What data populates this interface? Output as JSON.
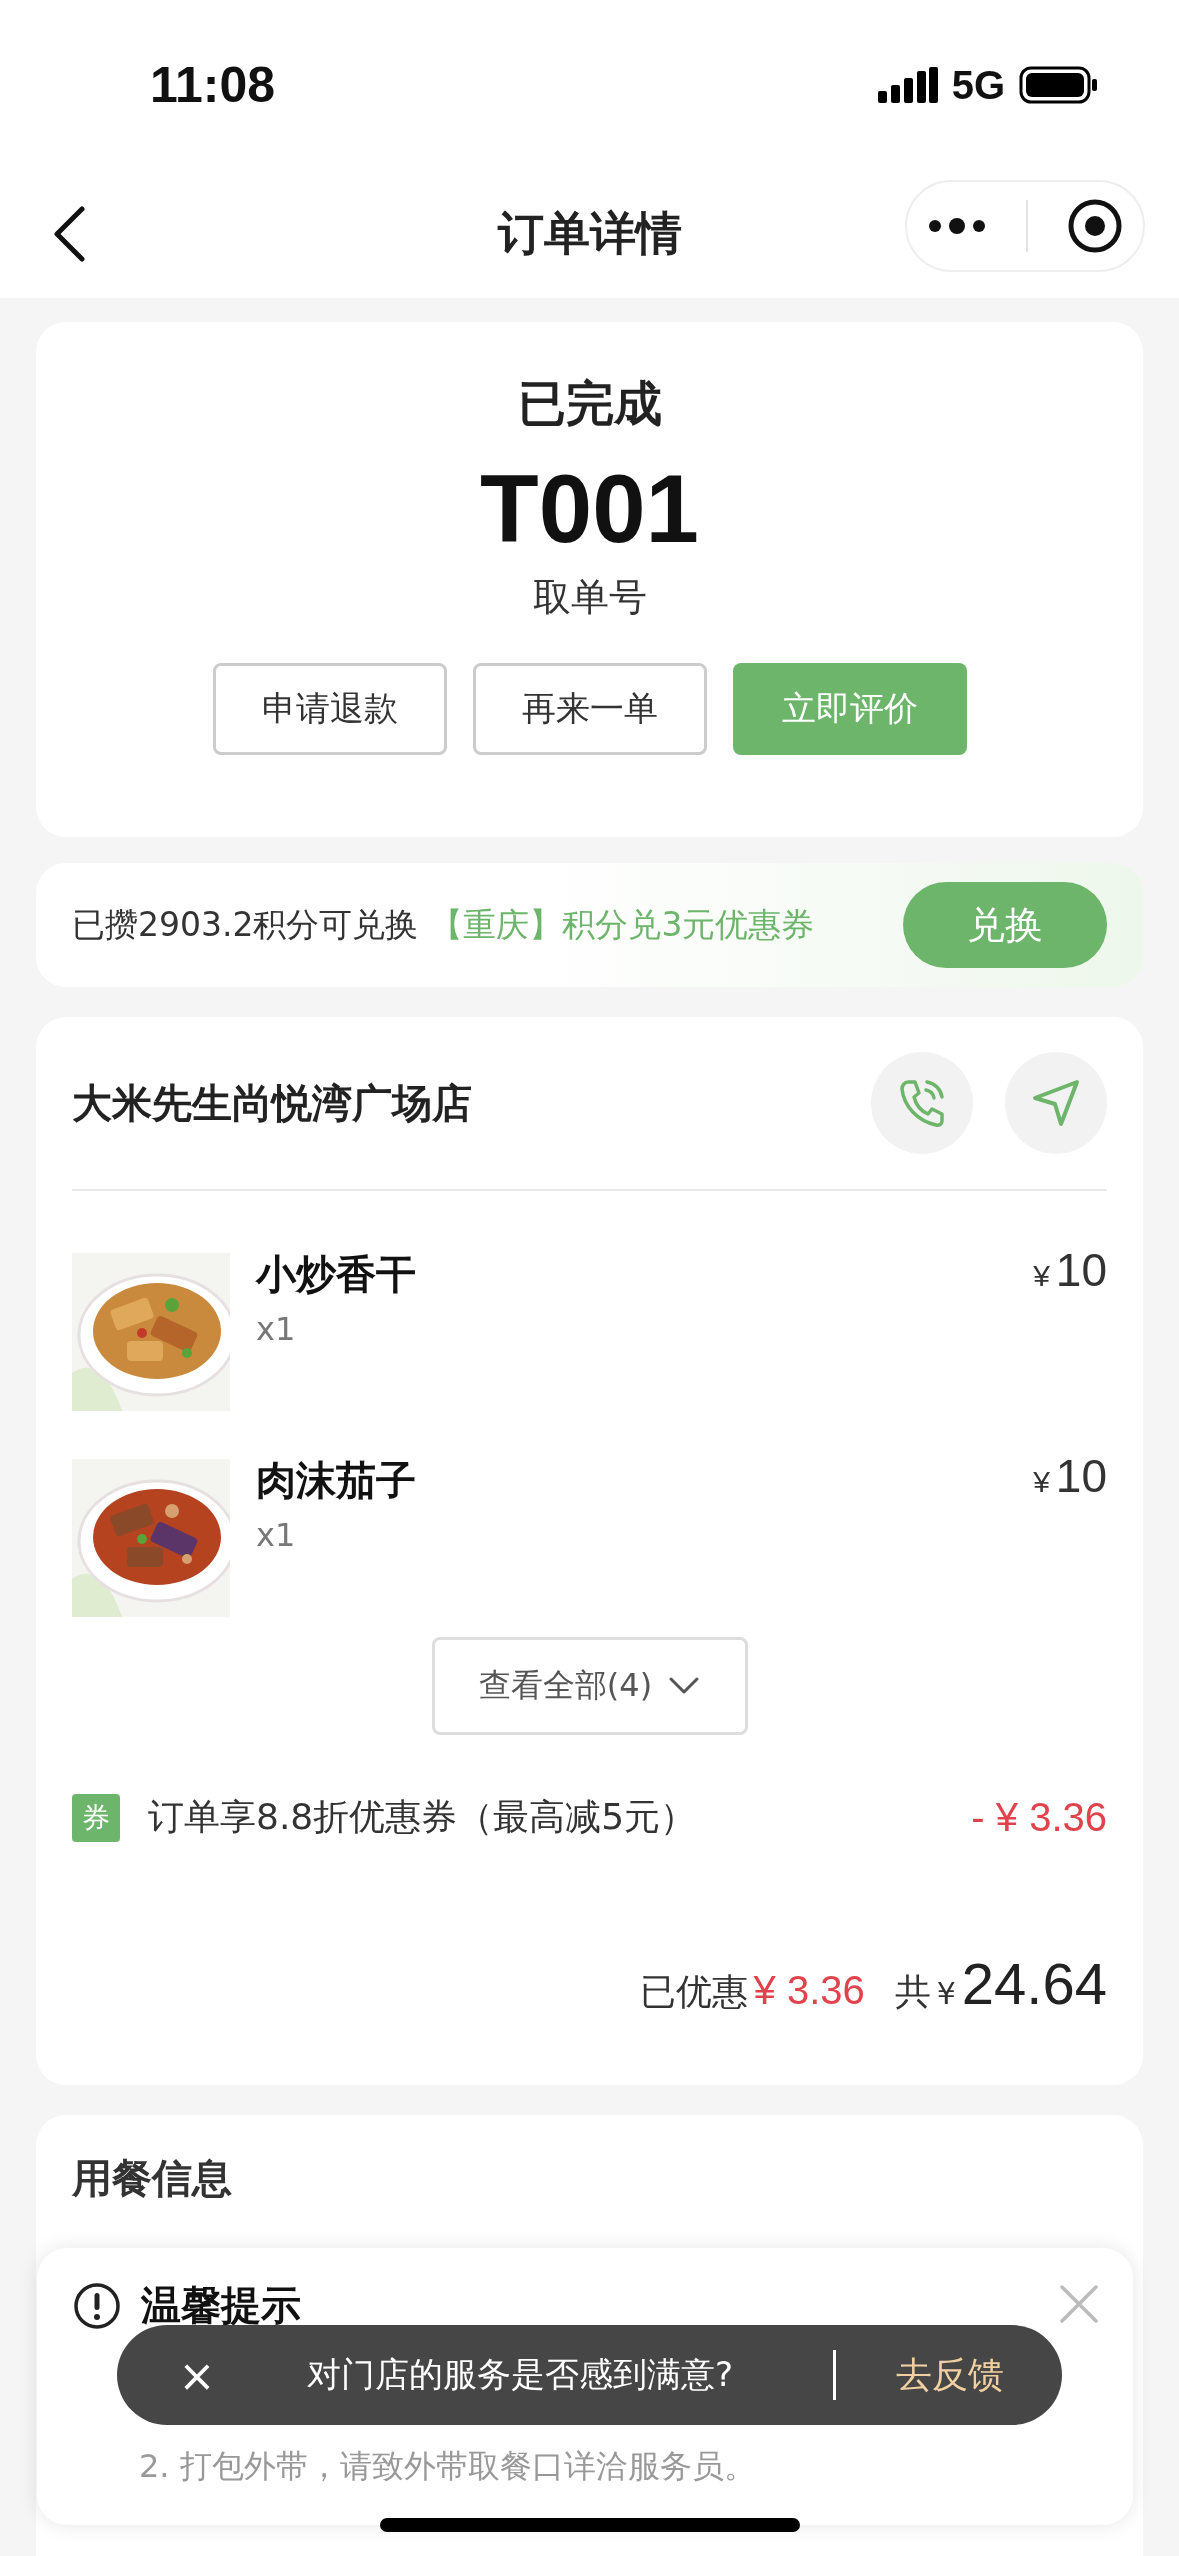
{
  "status_bar": {
    "time": "11:08",
    "network": "5G"
  },
  "nav": {
    "title": "订单详情"
  },
  "order": {
    "status": "已完成",
    "pickup_number": "T001",
    "pickup_label": "取单号",
    "actions": [
      {
        "label": "申请退款",
        "kind": "outline"
      },
      {
        "label": "再来一单",
        "kind": "outline"
      },
      {
        "label": "立即评价",
        "kind": "primary"
      }
    ]
  },
  "points_banner": {
    "text": "已攒2903.2积分可兑换",
    "offer": "【重庆】积分兑3元优惠券",
    "button": "兑换"
  },
  "store": {
    "name": "大米先生尚悦湾广场店",
    "items": [
      {
        "name": "小炒香干",
        "quantity": "x1",
        "currency": "¥",
        "price": "10",
        "kind": "tofu"
      },
      {
        "name": "肉沫茄子",
        "quantity": "x1",
        "currency": "¥",
        "price": "10",
        "kind": "eggplant"
      }
    ],
    "view_all": "查看全部(4)",
    "coupon": {
      "badge": "券",
      "text": "订单享8.8折优惠券（最高减5元）",
      "amount": "- ¥ 3.36"
    },
    "summary": {
      "discount_label": "已优惠",
      "discount": "¥ 3.36",
      "total_label": "共",
      "currency": "¥",
      "total": "24.64"
    }
  },
  "dining_info": {
    "title": "用餐信息"
  },
  "tip": {
    "title": "温馨提示",
    "lines": [
      "2. 打包外带，请致外带取餐口详洽服务员。"
    ]
  },
  "toast": {
    "close": "×",
    "message": "对门店的服务是否感到满意?",
    "action": "去反馈"
  }
}
